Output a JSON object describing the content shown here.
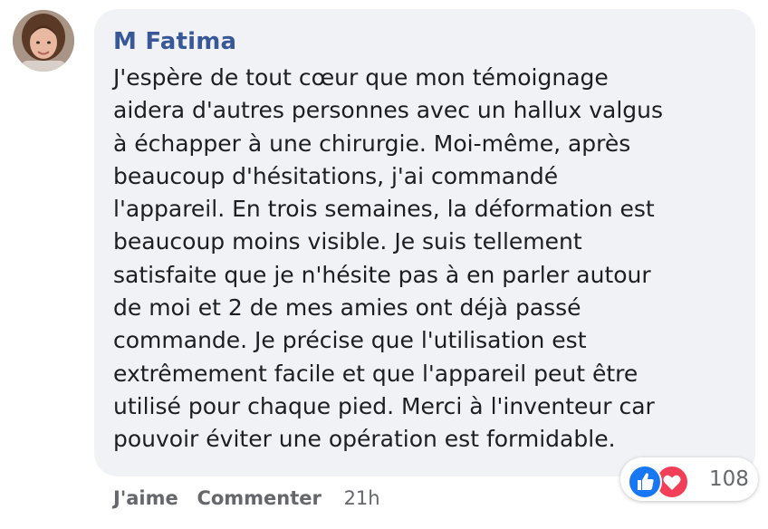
{
  "comment": {
    "author": "M Fatima",
    "text_lines": [
      "J'espère de tout cœur que mon témoignage",
      "aidera d'autres personnes avec un hallux valgus",
      "à échapper à une chirurgie. Moi-même, après",
      "beaucoup d'hésitations, j'ai commandé",
      "l'appareil. En trois semaines, la déformation est",
      "beaucoup moins visible. Je suis tellement",
      "satisfaite que je n'hésite pas à en parler autour",
      "de moi et 2 de mes amies ont déjà passé",
      "commande. Je précise que l'utilisation est",
      "extrêmement facile et que l'appareil peut être",
      "utilisé pour chaque pied. Merci à l'inventeur car",
      "pouvoir éviter une opération est formidable."
    ]
  },
  "reactions": {
    "icons": [
      "like-icon",
      "love-icon"
    ],
    "count": "108"
  },
  "actions": {
    "like_label": "J'aime",
    "reply_label": "Commenter",
    "timestamp": "21h"
  },
  "colors": {
    "author_name": "#385898",
    "bubble_background": "#f0f2f5",
    "like_blue": "#1877f2",
    "love_red": "#f33e58",
    "muted_text": "#65676b"
  }
}
